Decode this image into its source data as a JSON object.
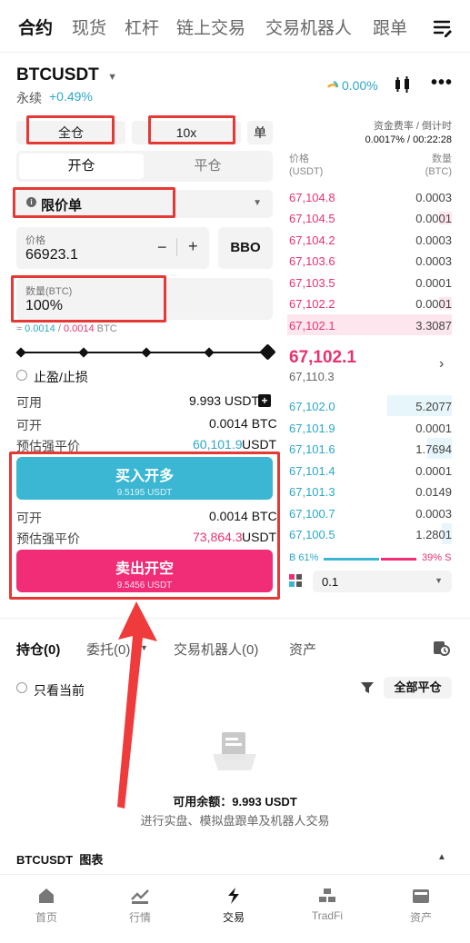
{
  "top_tabs": [
    "合约",
    "现货",
    "杠杆",
    "链上交易",
    "交易机器人",
    "跟单"
  ],
  "ticker": {
    "symbol": "BTCUSDT",
    "type": "永续",
    "change": "+0.49%",
    "pnl_pct": "0.00%"
  },
  "order_form": {
    "margin_mode": "全仓",
    "leverage": "10x",
    "single": "单",
    "tab_open": "开仓",
    "tab_close": "平仓",
    "order_type": "限价单",
    "price_label": "价格",
    "price_value": "66923.1",
    "minus": "−",
    "plus": "+",
    "bbo": "BBO",
    "qty_label": "数量(BTC)",
    "qty_value": "100%",
    "qty_hint_prefix": "≈",
    "qty_hint_a": "0.0014",
    "qty_hint_sep": "/",
    "qty_hint_b": "0.0014",
    "qty_hint_unit": "BTC",
    "tpsl": "止盈/止损",
    "available_label": "可用",
    "available_value": "9.993 USDT",
    "open_label": "可开",
    "open_value_buy": "0.0014 BTC",
    "liq_label": "预估强平价",
    "liq_buy_value": "60,101.9",
    "liq_unit": "USDT",
    "buy_label": "买入开多",
    "buy_sub": "9.5195 USDT",
    "open_value_sell": "0.0014 BTC",
    "liq_sell_value": "73,864.3",
    "sell_label": "卖出开空",
    "sell_sub": "9.5456 USDT"
  },
  "orderbook": {
    "funding_label": "资金费率 / 倒计时",
    "funding_value": "0.0017% / 00:22:28",
    "price_header": "价格",
    "price_unit": "(USDT)",
    "qty_header": "数量",
    "qty_unit": "(BTC)",
    "asks": [
      {
        "price": "67,104.8",
        "qty": "0.0003"
      },
      {
        "price": "67,104.5",
        "qty": "0.0001"
      },
      {
        "price": "67,104.2",
        "qty": "0.0003"
      },
      {
        "price": "67,103.6",
        "qty": "0.0003"
      },
      {
        "price": "67,103.5",
        "qty": "0.0001"
      },
      {
        "price": "67,102.2",
        "qty": "0.0001"
      },
      {
        "price": "67,102.1",
        "qty": "3.3087"
      }
    ],
    "last_price": "67,102.1",
    "mark_price": "67,110.3",
    "bids": [
      {
        "price": "67,102.0",
        "qty": "5.2077"
      },
      {
        "price": "67,101.9",
        "qty": "0.0001"
      },
      {
        "price": "67,101.6",
        "qty": "1.7694"
      },
      {
        "price": "67,101.4",
        "qty": "0.0001"
      },
      {
        "price": "67,101.3",
        "qty": "0.0149"
      },
      {
        "price": "67,100.7",
        "qty": "0.0003"
      },
      {
        "price": "67,100.5",
        "qty": "1.2801"
      }
    ],
    "buy_ratio": "B 61%",
    "sell_ratio": "39% S",
    "precision": "0.1"
  },
  "positions": {
    "tabs": [
      "持仓(0)",
      "委托(0)",
      "交易机器人(0)",
      "资产"
    ],
    "only_current": "只看当前",
    "close_all": "全部平仓",
    "balance_label": "可用余额：",
    "balance_value": "9.993 USDT",
    "empty_hint": "进行实盘、模拟盘跟单及机器人交易"
  },
  "chart_section": {
    "title": "BTCUSDT  图表"
  },
  "bottom_nav": [
    "首页",
    "行情",
    "交易",
    "TradFi",
    "资产"
  ],
  "colors": {
    "buy": "#3bb7d3",
    "sell": "#f02d76",
    "annotation": "#e53935"
  }
}
